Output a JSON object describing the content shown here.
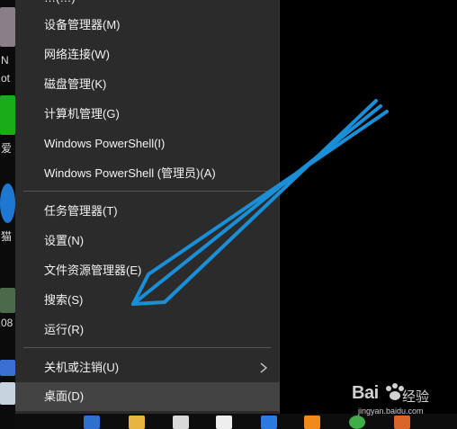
{
  "menu": {
    "partial_top": "…(…)",
    "items": [
      {
        "label": "设备管理器(M)"
      },
      {
        "label": "网络连接(W)"
      },
      {
        "label": "磁盘管理(K)"
      },
      {
        "label": "计算机管理(G)"
      },
      {
        "label": "Windows PowerShell(I)"
      },
      {
        "label": "Windows PowerShell (管理员)(A)"
      },
      {
        "label": "任务管理器(T)"
      },
      {
        "label": "设置(N)"
      },
      {
        "label": "文件资源管理器(E)"
      },
      {
        "label": "搜索(S)"
      },
      {
        "label": "运行(R)"
      },
      {
        "label": "关机或注销(U)"
      },
      {
        "label": "桌面(D)"
      }
    ]
  },
  "desktop_side_text": [
    "N",
    "ot",
    "爱",
    "猫",
    "08"
  ],
  "watermark": {
    "brand": "Bai",
    "brand_cn": "经验",
    "url": "jingyan.baidu.com"
  },
  "colors": {
    "menu_bg": "#2b2b2b",
    "highlight": "#434343",
    "arrow": "#1a8fd8"
  }
}
